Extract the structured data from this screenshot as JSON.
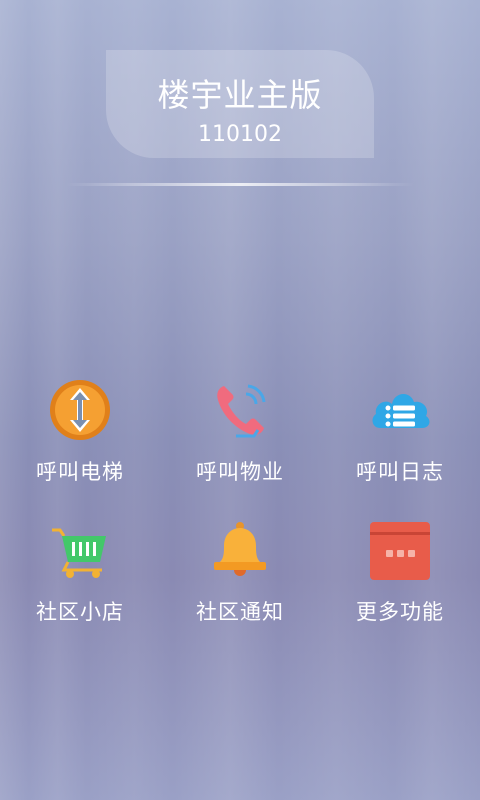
{
  "header": {
    "title": "楼宇业主版",
    "code": "110102"
  },
  "menu": [
    {
      "label": "呼叫电梯",
      "icon": "elevator-icon"
    },
    {
      "label": "呼叫物业",
      "icon": "phone-call-icon"
    },
    {
      "label": "呼叫日志",
      "icon": "list-cloud-icon"
    },
    {
      "label": "社区小店",
      "icon": "shopping-cart-icon"
    },
    {
      "label": "社区通知",
      "icon": "bell-icon"
    },
    {
      "label": "更多功能",
      "icon": "more-icon"
    }
  ],
  "colors": {
    "elevator": "#f39a23",
    "phone": "#f06b7e",
    "cloud": "#2fa7e6",
    "cart": "#43c86a",
    "bell": "#f9b13a",
    "more": "#e85c4a"
  }
}
